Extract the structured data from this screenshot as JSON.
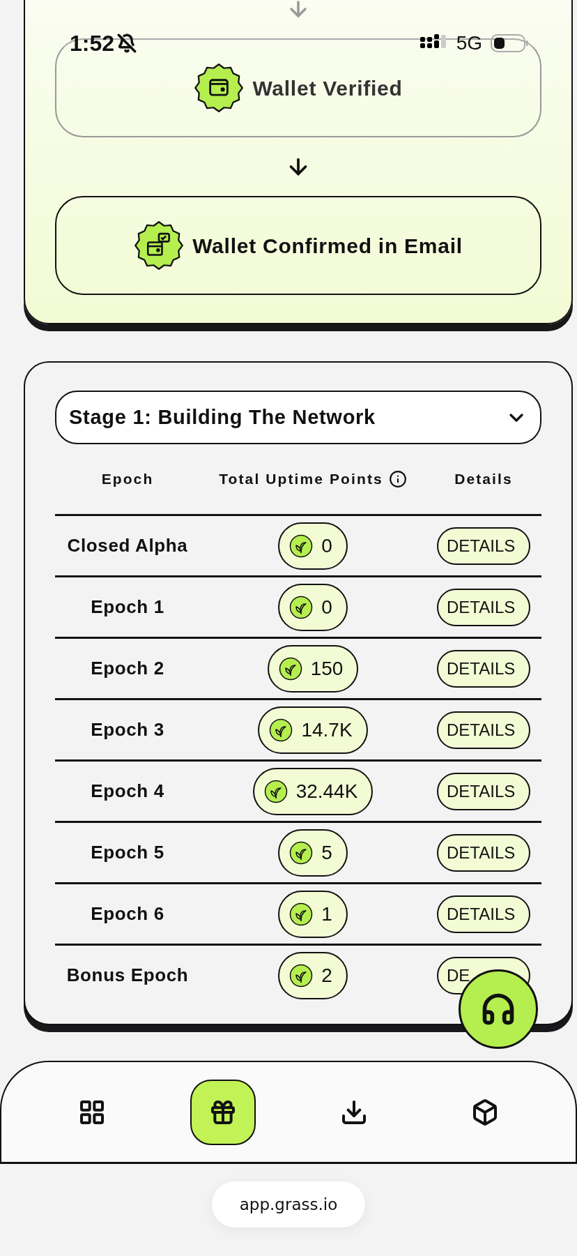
{
  "status_bar": {
    "time": "1:52",
    "network": "5G"
  },
  "steps": [
    {
      "label": "Wallet Verified",
      "kind": "wallet"
    },
    {
      "label": "Wallet Confirmed in Email",
      "kind": "wallet-email"
    }
  ],
  "stage_select": {
    "value": "Stage 1: Building The Network"
  },
  "table": {
    "columns": [
      "Epoch",
      "Total Uptime Points",
      "Details"
    ],
    "rows": [
      {
        "epoch": "Closed Alpha",
        "points": "0",
        "action": "DETAILS"
      },
      {
        "epoch": "Epoch 1",
        "points": "0",
        "action": "DETAILS"
      },
      {
        "epoch": "Epoch 2",
        "points": "150",
        "action": "DETAILS"
      },
      {
        "epoch": "Epoch 3",
        "points": "14.7K",
        "action": "DETAILS"
      },
      {
        "epoch": "Epoch 4",
        "points": "32.44K",
        "action": "DETAILS"
      },
      {
        "epoch": "Epoch 5",
        "points": "5",
        "action": "DETAILS"
      },
      {
        "epoch": "Epoch 6",
        "points": "1",
        "action": "DETAILS"
      },
      {
        "epoch": "Bonus Epoch",
        "points": "2",
        "action": "DE"
      }
    ]
  },
  "nav": [
    {
      "kind": "grid",
      "selected": false
    },
    {
      "kind": "gift",
      "selected": true
    },
    {
      "kind": "download",
      "selected": false
    },
    {
      "kind": "box",
      "selected": false
    }
  ],
  "url": "app.grass.io"
}
